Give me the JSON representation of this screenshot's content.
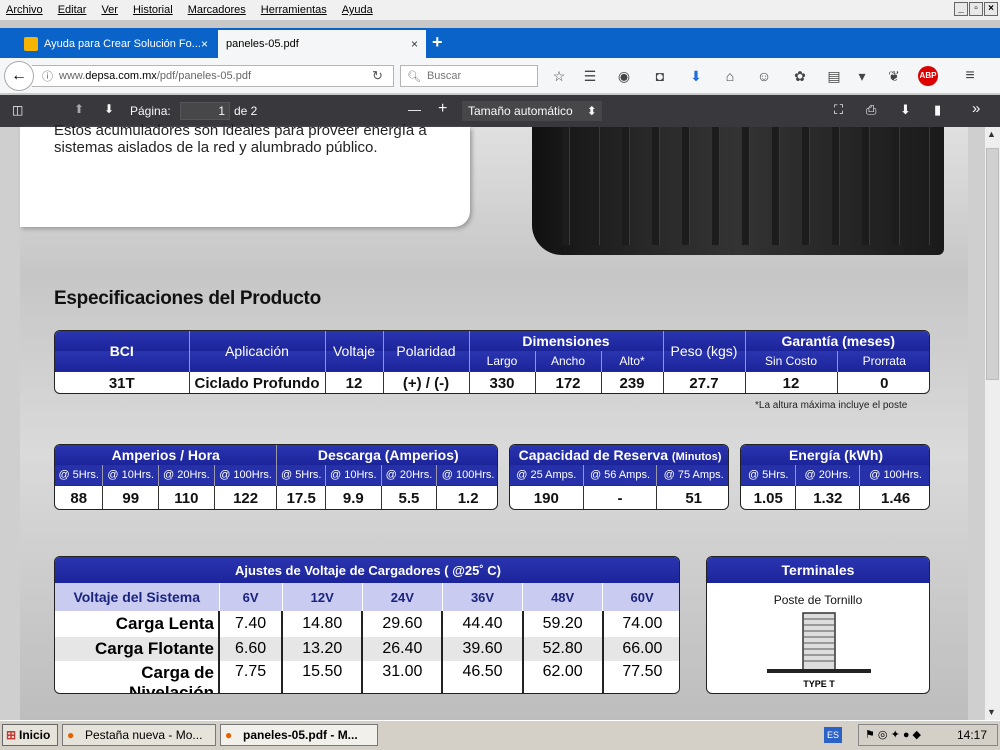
{
  "menu": [
    "Archivo",
    "Editar",
    "Ver",
    "Historial",
    "Marcadores",
    "Herramientas",
    "Ayuda"
  ],
  "tabs": [
    {
      "label": "Ayuda para Crear Solución Fo...",
      "close": "×"
    },
    {
      "label": "paneles-05.pdf",
      "close": "×"
    }
  ],
  "newtab": "+",
  "url": {
    "prefix": "www.",
    "host": "depsa.com.mx",
    "path": "/pdf/paneles-05.pdf"
  },
  "search": {
    "placeholder": "Buscar"
  },
  "pdf_toolbar": {
    "page_label": "Página:",
    "page_value": "1",
    "page_count": "de 2",
    "zoom": "Tamaño automático",
    "minus": "—",
    "plus": "+"
  },
  "doc": {
    "intro_lines": [
      "Estos acumuladores son ideales para proveer energía a",
      "sistemas aislados de la red y alumbrado público."
    ],
    "spec_title": "Especificaciones del Producto",
    "t1": {
      "headers": {
        "bci": "BCI",
        "aplicacion": "Aplicación",
        "voltaje": "Voltaje",
        "polaridad": "Polaridad",
        "dimensiones": "Dimensiones",
        "largo": "Largo",
        "ancho": "Ancho",
        "alto": "Alto*",
        "peso": "Peso (kgs)",
        "garantia": "Garantía (meses)",
        "sincosto": "Sin Costo",
        "prorrata": "Prorrata"
      },
      "row": [
        "31T",
        "Ciclado Profundo",
        "12",
        "(+) / (-)",
        "330",
        "172",
        "239",
        "27.7",
        "12",
        "0"
      ]
    },
    "note": "*La altura máxima incluye el poste",
    "t2": {
      "amp_title": "Amperios / Hora",
      "desc_title": "Descarga (Amperios)",
      "subs": [
        "@ 5Hrs.",
        "@ 10Hrs.",
        "@ 20Hrs.",
        "@ 100Hrs.",
        "@ 5Hrs.",
        "@ 10Hrs.",
        "@ 20Hrs.",
        "@ 100Hrs."
      ],
      "vals": [
        "88",
        "99",
        "110",
        "122",
        "17.5",
        "9.9",
        "5.5",
        "1.2"
      ]
    },
    "t3": {
      "title": "Capacidad de Reserva",
      "title_small": "(Minutos)",
      "subs": [
        "@ 25 Amps.",
        "@ 56 Amps.",
        "@ 75 Amps."
      ],
      "vals": [
        "190",
        "-",
        "51"
      ]
    },
    "t4": {
      "title": "Energía (kWh)",
      "subs": [
        "@ 5Hrs.",
        "@ 20Hrs.",
        "@ 100Hrs."
      ],
      "vals": [
        "1.05",
        "1.32",
        "1.46"
      ]
    },
    "t5": {
      "title": "Ajustes de Voltaje de Cargadores ( @25˚ C)",
      "col0": "Voltaje del Sistema",
      "cols": [
        "6V",
        "12V",
        "24V",
        "36V",
        "48V",
        "60V"
      ],
      "rows": [
        {
          "label": "Carga Lenta",
          "vals": [
            "7.40",
            "14.80",
            "29.60",
            "44.40",
            "59.20",
            "74.00"
          ]
        },
        {
          "label": "Carga Flotante",
          "vals": [
            "6.60",
            "13.20",
            "26.40",
            "39.60",
            "52.80",
            "66.00"
          ]
        },
        {
          "label": "Carga de Nivelación",
          "vals": [
            "7.75",
            "15.50",
            "31.00",
            "46.50",
            "62.00",
            "77.50"
          ]
        }
      ]
    },
    "t6": {
      "title": "Terminales",
      "caption": "Poste de Tornillo",
      "type": "TYPE T"
    }
  },
  "taskbar": {
    "start": "Inicio",
    "items": [
      "Pestaña nueva - Mo...",
      "paneles-05.pdf - M..."
    ],
    "lang": "ES",
    "clock": "14:17"
  }
}
